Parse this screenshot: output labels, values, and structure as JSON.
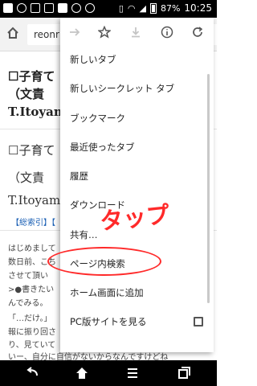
{
  "status_bar": {
    "battery": "87%",
    "time": "10:25",
    "left_icons": [
      "image-icon",
      "notification-icon",
      "link-icon",
      "calendar-icon",
      "image-icon",
      "google-icon",
      "check-icon"
    ],
    "right_icons": [
      "vibrate-icon",
      "signal-icon",
      "nfc-icon",
      "wifi-icon",
      "cellular-icon"
    ]
  },
  "toolbar": {
    "home_icon": "home-icon",
    "url": "reonr"
  },
  "page": {
    "title_1": "☐子育て",
    "title_2": "（文責",
    "author_1": "T.Itoyam",
    "big_1": "☐子育て",
    "big_2": "（文責",
    "author_2": "T.Itoyam",
    "links": "【総索引】【",
    "body": [
      "はじめまして",
      "数日前、こち",
      "させて頂い",
      ">●書きたい",
      "んでみる。",
      "「…だけ。」",
      "報に振り回さ",
      "り、見ていて",
      "いー、自分に自信がないからなんですけどね"
    ]
  },
  "menu": {
    "icons": [
      "forward-icon",
      "star-icon",
      "download-icon",
      "info-icon",
      "refresh-icon"
    ],
    "items": [
      {
        "label": "新しいタブ"
      },
      {
        "label": "新しいシークレット タブ"
      },
      {
        "label": "ブックマーク"
      },
      {
        "label": "最近使ったタブ"
      },
      {
        "label": "履歴"
      },
      {
        "label": "ダウンロード"
      },
      {
        "label": "共有…"
      },
      {
        "label": "ページ内検索"
      },
      {
        "label": "ホーム画面に追加"
      },
      {
        "label": "PC版サイトを見る"
      }
    ],
    "desktop_site_checked": false
  },
  "annotation": {
    "text": "タップ",
    "color": "#ff2a2a"
  },
  "nav_bar": {
    "icons": [
      "back-icon",
      "home-icon",
      "menu-icon",
      "recent-apps-icon"
    ]
  }
}
